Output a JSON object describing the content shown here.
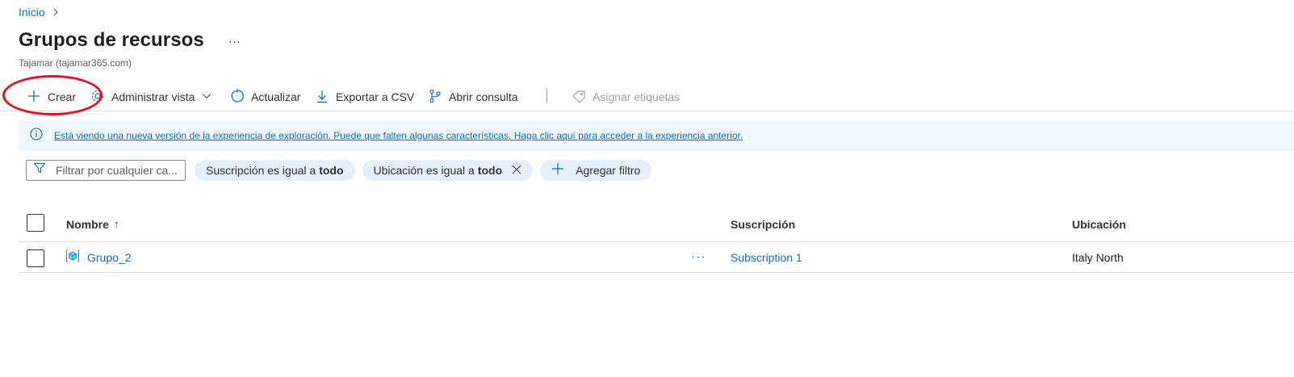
{
  "breadcrumb": {
    "home": "Inicio"
  },
  "page": {
    "title": "Grupos de recursos",
    "more": "···",
    "subtitle": "Tajamar (tajamar365.com)"
  },
  "toolbar": {
    "create": "Crear",
    "manage_view": "Administrar vista",
    "refresh": "Actualizar",
    "export_csv": "Exportar a CSV",
    "open_query": "Abrir consulta",
    "assign_tags": "Asignar etiquetas"
  },
  "banner": {
    "message": "Está viendo una nueva versión de la experiencia de exploración. Puede que falten algunas características. Haga clic aquí para acceder a la experiencia anterior."
  },
  "filters": {
    "search_placeholder": "Filtrar por cualquier ca...",
    "subscription_label": "Suscripción es igual a",
    "subscription_value": "todo",
    "location_label": "Ubicación es igual a",
    "location_value": "todo",
    "add_filter": "Agregar filtro"
  },
  "table": {
    "columns": {
      "name": "Nombre",
      "name_sort": "↑",
      "subscription": "Suscripción",
      "location": "Ubicación"
    },
    "rows": [
      {
        "name": "Grupo_2",
        "more": "···",
        "subscription": "Subscription 1",
        "location": "Italy North"
      }
    ]
  },
  "colors": {
    "link": "#0f6cbd",
    "annotation_circle": "#e81123",
    "pill_bg": "#e5f0fb",
    "banner_bg": "#eff6fc"
  }
}
